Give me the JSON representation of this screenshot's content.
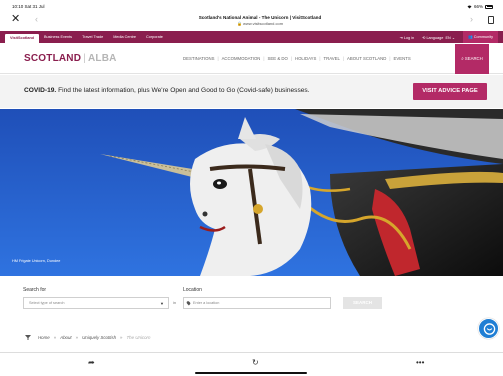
{
  "status": {
    "time": "10:10",
    "date": "Sat 31 Jul",
    "battery": "66%"
  },
  "browser": {
    "page_title": "Scotland's National Animal - The Unicorn | VisitScotland",
    "url": "www.visitscotland.com"
  },
  "topbar": {
    "tabs": [
      "VisitScotland",
      "Business Events",
      "Travel Trade",
      "Media Centre",
      "Corporate"
    ],
    "login": "Log in",
    "language_label": "Language",
    "language_value": "EN",
    "community": "Community"
  },
  "logo": {
    "scotland": "SCOTLAND",
    "alba": "ALBA"
  },
  "nav": {
    "items": [
      "DESTINATIONS",
      "ACCOMMODATION",
      "SEE & DO",
      "HOLIDAYS",
      "TRAVEL",
      "ABOUT SCOTLAND",
      "EVENTS"
    ],
    "search": "SEARCH"
  },
  "covid": {
    "bold": "COVID-19.",
    "text": " Find the latest information, plus We're Open and Good to Go (Covid-safe) businesses.",
    "button": "VISIT ADVICE PAGE"
  },
  "hero": {
    "caption": "HM Frigate Unicorn, Dundee"
  },
  "search": {
    "search_for_label": "Search for",
    "type_placeholder": "Select type of search",
    "in_word": "in",
    "location_label": "Location",
    "location_placeholder": "Enter a location",
    "button": "SEARCH"
  },
  "breadcrumb": [
    "Home",
    "About",
    "Uniquely Scottish",
    "The Unicorn"
  ],
  "colors": {
    "brand": "#8a1e4e",
    "accent": "#b32a66",
    "chat": "#1f7ed4"
  }
}
